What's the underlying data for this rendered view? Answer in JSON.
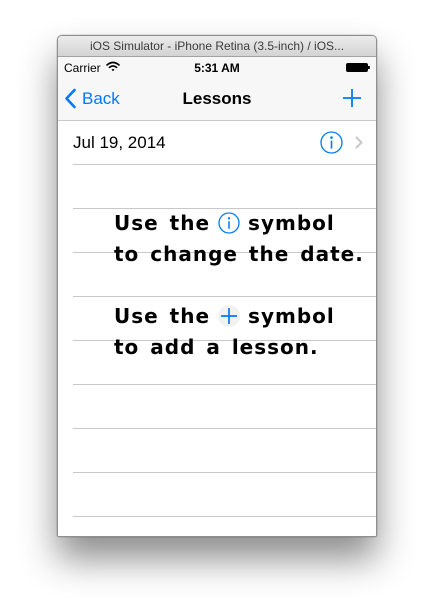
{
  "window": {
    "title": "iOS Simulator - iPhone Retina (3.5-inch) / iOS..."
  },
  "statusbar": {
    "carrier": "Carrier",
    "time": "5:31 AM"
  },
  "navbar": {
    "back_label": "Back",
    "title": "Lessons"
  },
  "list": {
    "date_label": "Jul 19, 2014"
  },
  "hints": {
    "info_line1_before": "Use the",
    "info_line1_after": "symbol",
    "info_line2": "to change the date.",
    "add_line1_before": "Use the",
    "add_line1_after": "symbol",
    "add_line2": "to add a lesson."
  },
  "colors": {
    "tint": "#007aff",
    "separator": "#c8c7cc",
    "bar_background": "#f7f7f7"
  },
  "icons": {
    "back": "chevron-left-icon",
    "add": "plus-icon",
    "info": "info-icon",
    "disclosure": "chevron-right-icon",
    "wifi": "wifi-icon",
    "battery": "battery-icon"
  }
}
